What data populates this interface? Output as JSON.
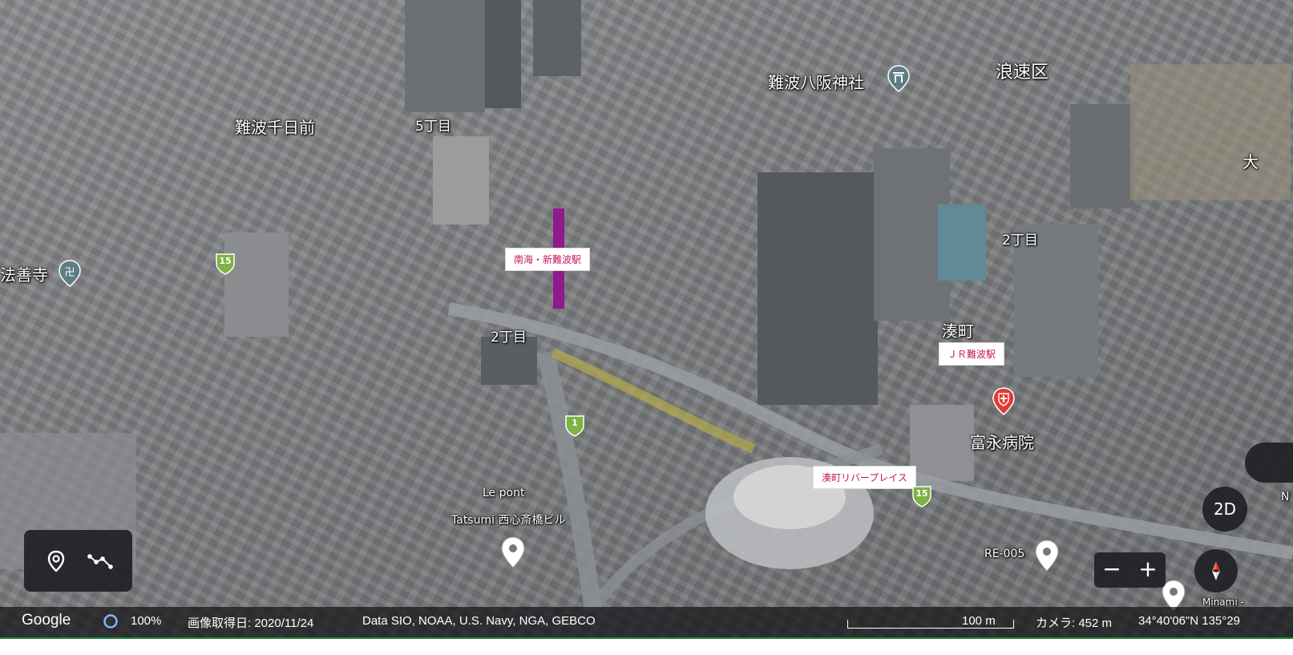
{
  "map_labels": {
    "namba_sennichimae": "難波千日前",
    "gochome": "5丁目",
    "namba_yasaka": "難波八阪神社",
    "naniwa_ku": "浪速区",
    "dai": "大",
    "nichome_right": "2丁目",
    "hozenji": "法善寺",
    "nichome_center": "2丁目",
    "minatomachi": "湊町",
    "tominaga": "富永病院",
    "le_pont": "Le pont",
    "tatsumi": "Tatsumi 西心斎橋ビル",
    "re005": "RE-005",
    "minami_partial": "Minami -",
    "n_partial": "N"
  },
  "stations": {
    "nankai_namba": "南海・新難波駅",
    "jr_namba": "ＪＲ難波駅",
    "minatomachi_river": "湊町リバープレイス"
  },
  "route_shields": {
    "left": "15",
    "center": "1",
    "bottom": "15"
  },
  "controls": {
    "view_mode_label": "2D",
    "zoom_out_label": "−",
    "zoom_in_label": "+"
  },
  "bottom_bar": {
    "logo": "Google",
    "progress": "100%",
    "image_date": "画像取得日: 2020/11/24",
    "data_credit": "Data SIO, NOAA, U.S. Navy, NGA, GEBCO",
    "scale": "100 m",
    "camera": "カメラ: 452 m",
    "coords": "34°40'06\"N 135°29"
  },
  "colors": {
    "station_text": "#c2185b",
    "shield_green": "#7cb342",
    "hospital_red": "#e53935",
    "accent_blue": "#8ab4f8"
  },
  "icons": [
    "place-pin-icon",
    "measure-path-icon",
    "compass-icon",
    "shrine-icon",
    "temple-icon",
    "hospital-icon",
    "placemark-pin-icon",
    "loading-ring-icon"
  ]
}
